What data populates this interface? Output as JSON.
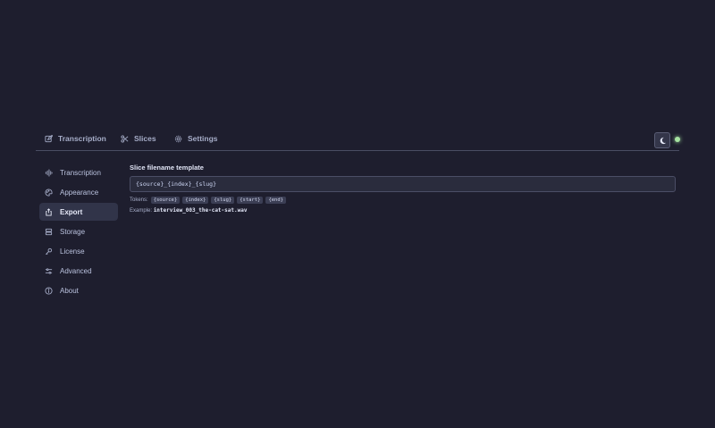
{
  "tabs": [
    {
      "label": "Transcription",
      "icon": "edit-icon"
    },
    {
      "label": "Slices",
      "icon": "scissors-icon"
    },
    {
      "label": "Settings",
      "icon": "gear-icon"
    }
  ],
  "header": {
    "theme_icon": "moon-icon",
    "status_color": "#a6e3a1"
  },
  "sidebar": {
    "items": [
      {
        "label": "Transcription",
        "icon": "waveform-icon"
      },
      {
        "label": "Appearance",
        "icon": "palette-icon"
      },
      {
        "label": "Export",
        "icon": "share-icon",
        "active": true
      },
      {
        "label": "Storage",
        "icon": "storage-icon"
      },
      {
        "label": "License",
        "icon": "key-icon"
      },
      {
        "label": "Advanced",
        "icon": "sliders-icon"
      },
      {
        "label": "About",
        "icon": "info-icon"
      }
    ]
  },
  "export": {
    "template_label": "Slice filename template",
    "template_value": "{source}_{index}_{slug}",
    "tokens_label": "Tokens:",
    "tokens": [
      "{source}",
      "{index}",
      "{slug}",
      "{start}",
      "{end}"
    ],
    "example_label": "Example:",
    "example_value": "interview_003_the-cat-sat.wav"
  },
  "colors": {
    "background": "#1e1e2e",
    "active_item": "#313449",
    "status_green": "#a6e3a1"
  }
}
